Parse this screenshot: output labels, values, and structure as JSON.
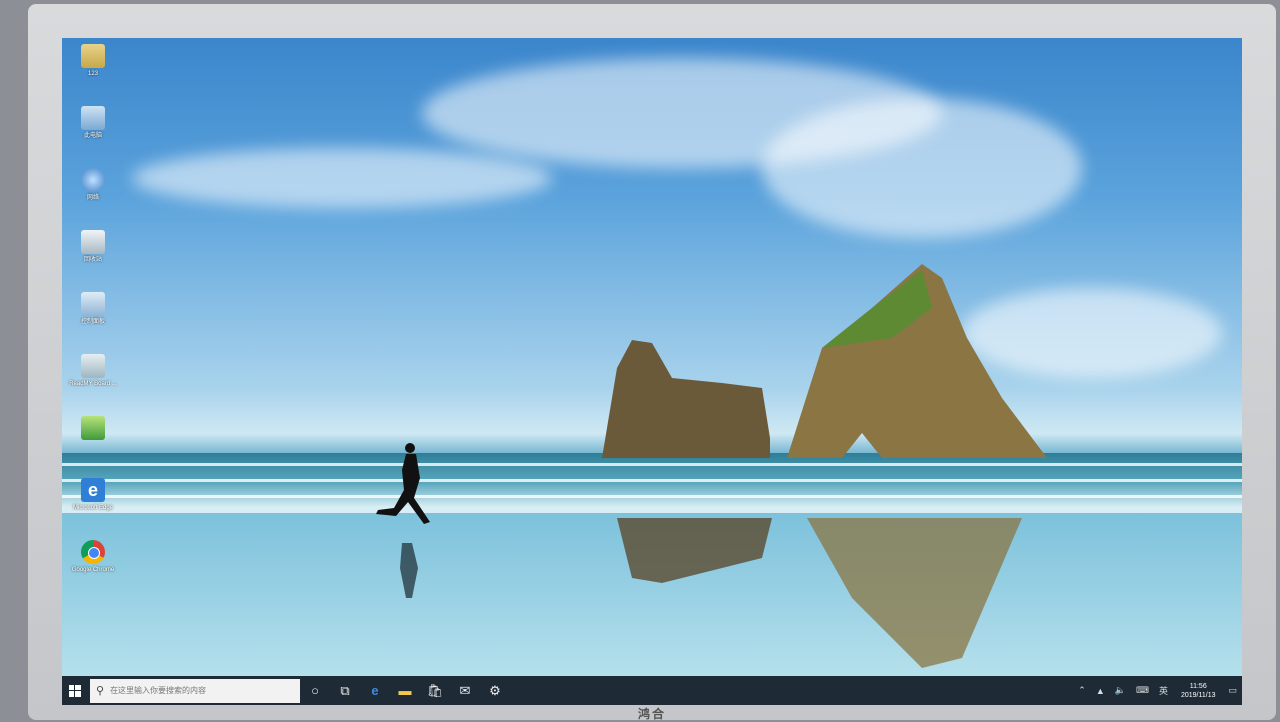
{
  "desktop_icons": [
    {
      "label": "123",
      "icon": "user-folder-icon"
    },
    {
      "label": "此电脑",
      "icon": "computer-icon"
    },
    {
      "label": "网络",
      "icon": "network-icon"
    },
    {
      "label": "回收站",
      "icon": "recycle-bin-icon"
    },
    {
      "label": "控制面板",
      "icon": "control-panel-icon"
    },
    {
      "label": "ReadMY Board ...",
      "icon": "board-icon"
    },
    {
      "label": "",
      "icon": "picture-icon"
    },
    {
      "label": "Microsoft Edge",
      "icon": "edge-icon"
    },
    {
      "label": "Google Chrome",
      "icon": "chrome-icon"
    }
  ],
  "taskbar": {
    "search_placeholder": "在这里输入你要搜索的内容",
    "apps": [
      "cortana-icon",
      "task-view-icon",
      "edge-icon",
      "file-explorer-icon",
      "store-icon",
      "mail-icon",
      "settings-icon"
    ],
    "tray_lang": "英",
    "time": "11:56",
    "date": "2019/11/13"
  },
  "monitor_brand": "鸿合"
}
